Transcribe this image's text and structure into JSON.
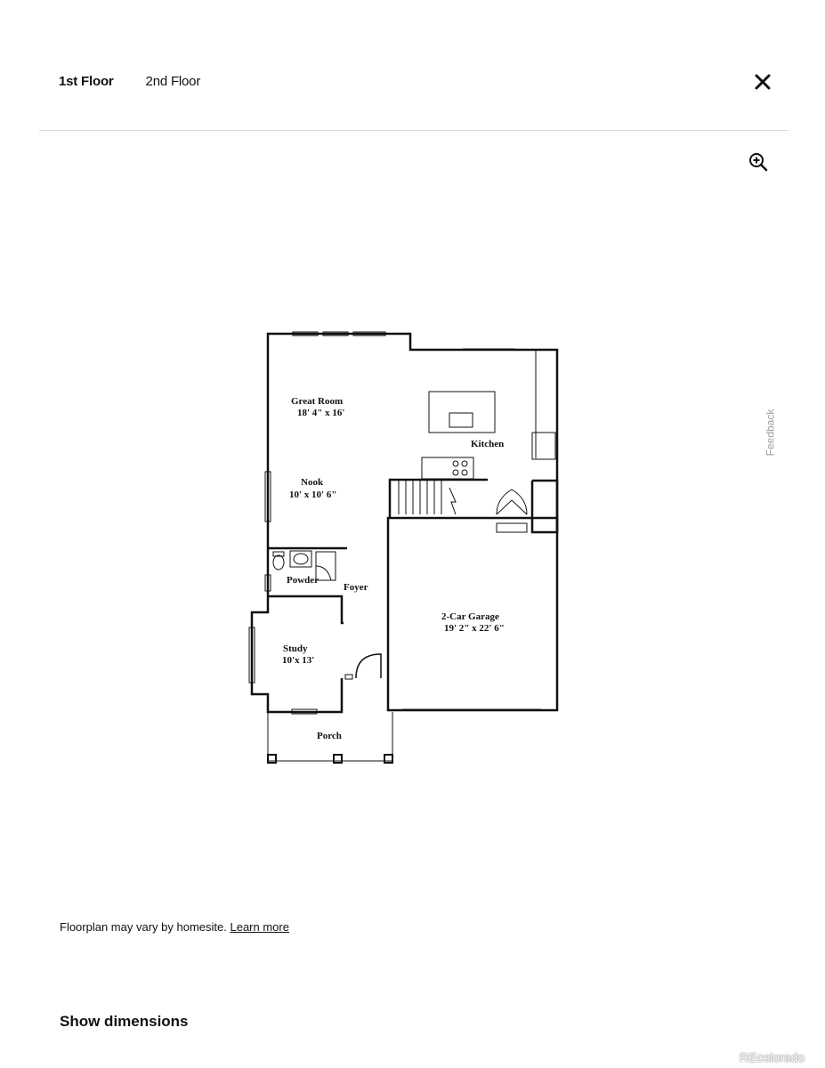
{
  "tabs": [
    {
      "label": "1st Floor",
      "active": true
    },
    {
      "label": "2nd Floor",
      "active": false
    }
  ],
  "icons": {
    "close": "close-icon",
    "zoom": "zoom-in-icon"
  },
  "feedback_label": "Feedback",
  "floorplan": {
    "rooms": {
      "great_room": {
        "name": "Great Room",
        "size": "18' 4\" x 16'"
      },
      "kitchen": {
        "name": "Kitchen"
      },
      "nook": {
        "name": "Nook",
        "size": "10' x 10' 6\""
      },
      "powder": {
        "name": "Powder"
      },
      "foyer": {
        "name": "Foyer"
      },
      "garage": {
        "name": "2-Car Garage",
        "size": "19' 2\" x 22' 6\""
      },
      "study": {
        "name": "Study",
        "size": "10'x 13'"
      },
      "porch": {
        "name": "Porch"
      }
    }
  },
  "note": {
    "text": "Floorplan may vary by homesite.",
    "link": "Learn more"
  },
  "show_dimensions_label": "Show dimensions",
  "watermark": "REcolorado"
}
